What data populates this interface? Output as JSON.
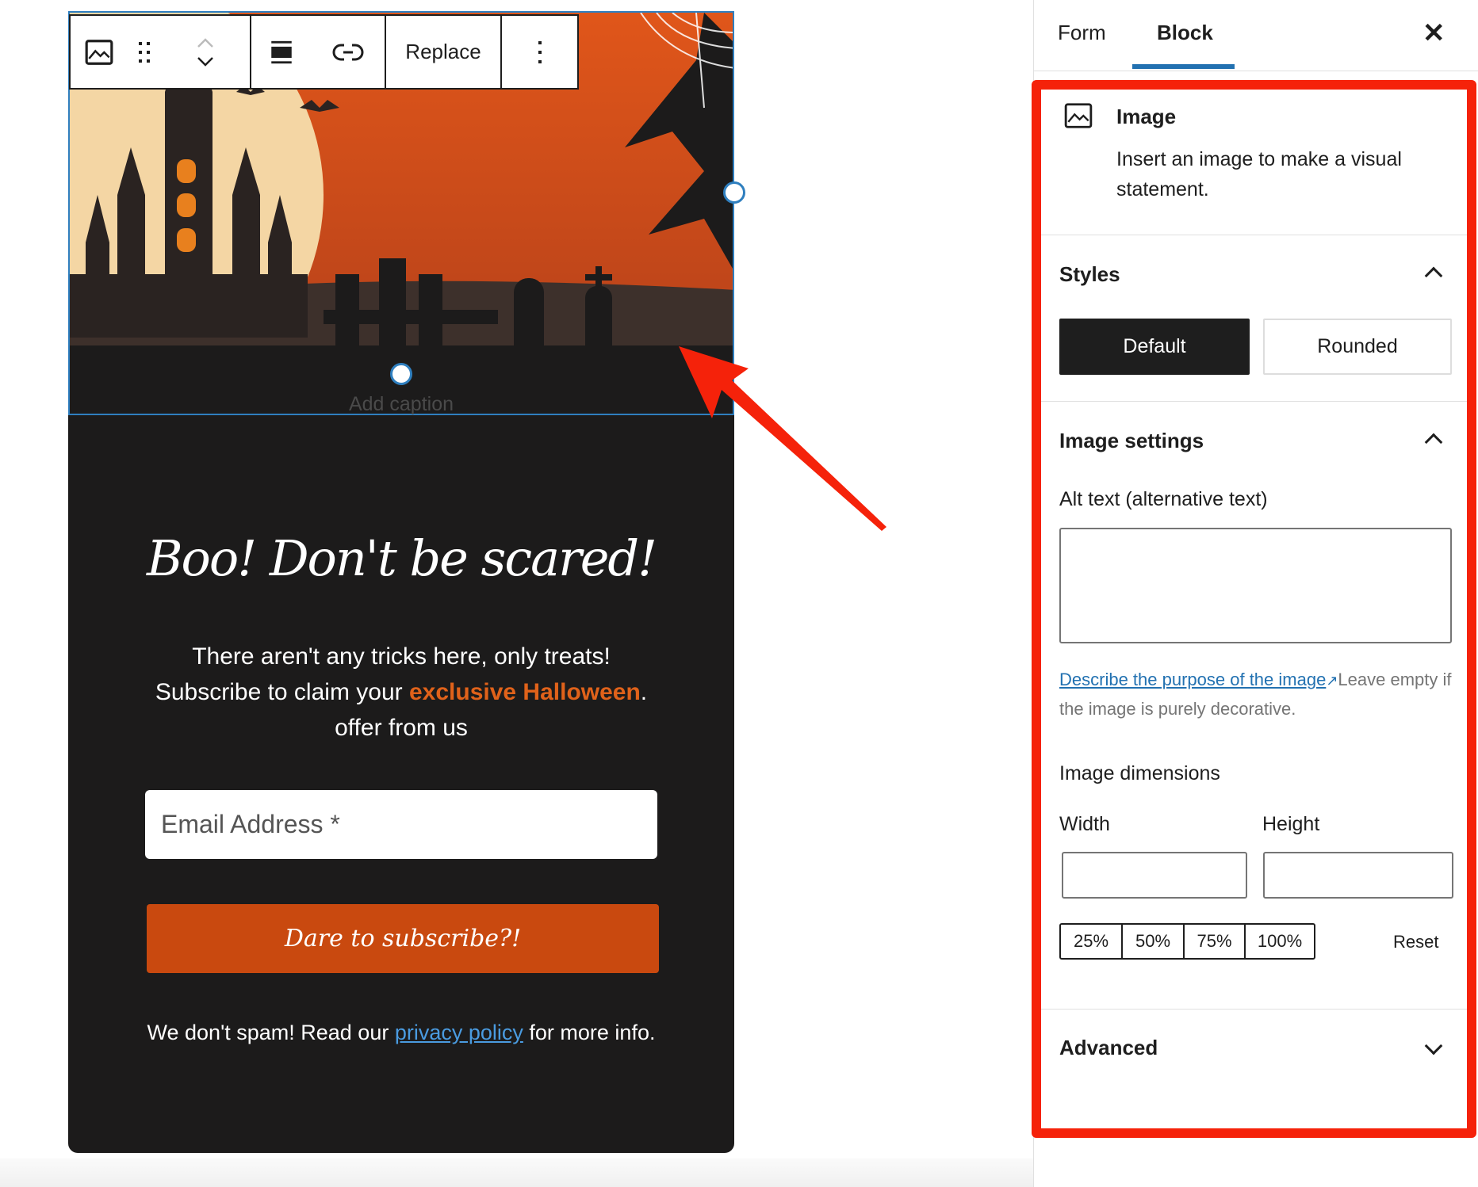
{
  "editor": {
    "toolbar": {
      "replace_label": "Replace",
      "icons": [
        "image-icon",
        "drag-handle-icon",
        "move-up-icon",
        "move-down-icon",
        "align-icon",
        "link-icon",
        "more-options-icon"
      ]
    },
    "caption_placeholder": "Add caption",
    "form": {
      "heading": "Boo! Don't be scared!",
      "text_line1": "There aren't any tricks here, only treats!",
      "text_line2_before": "Subscribe to claim your ",
      "text_highlight": "exclusive Halloween",
      "text_line2_after": ".",
      "text_line3": "offer from us",
      "email_placeholder": "Email Address *",
      "submit_label": "Dare to subscribe?!",
      "footer_before": "We don't spam! Read our ",
      "footer_link": "privacy policy",
      "footer_after": " for more info."
    },
    "colors": {
      "accent": "#c9490f",
      "highlight": "#e0621a",
      "selection": "#2f7fbf",
      "card": "#1c1b1b"
    }
  },
  "sidebar": {
    "tabs": [
      {
        "label": "Form",
        "active": false
      },
      {
        "label": "Block",
        "active": true
      }
    ],
    "close_icon": "close-icon",
    "block": {
      "title": "Image",
      "description": "Insert an image to make a visual statement."
    },
    "styles": {
      "title": "Styles",
      "options": [
        {
          "label": "Default",
          "selected": true
        },
        {
          "label": "Rounded",
          "selected": false
        }
      ]
    },
    "image_settings": {
      "title": "Image settings",
      "alt_label": "Alt text (alternative text)",
      "alt_value": "",
      "help_link": "Describe the purpose of the image",
      "help_text": "Leave empty if the image is purely decorative.",
      "dimensions_label": "Image dimensions",
      "width_label": "Width",
      "height_label": "Height",
      "width_value": "",
      "height_value": "",
      "percent_options": [
        "25%",
        "50%",
        "75%",
        "100%"
      ],
      "reset_label": "Reset"
    },
    "advanced": {
      "title": "Advanced"
    },
    "highlight_color": "#f5220a",
    "tab_accent": "#2271b1"
  }
}
